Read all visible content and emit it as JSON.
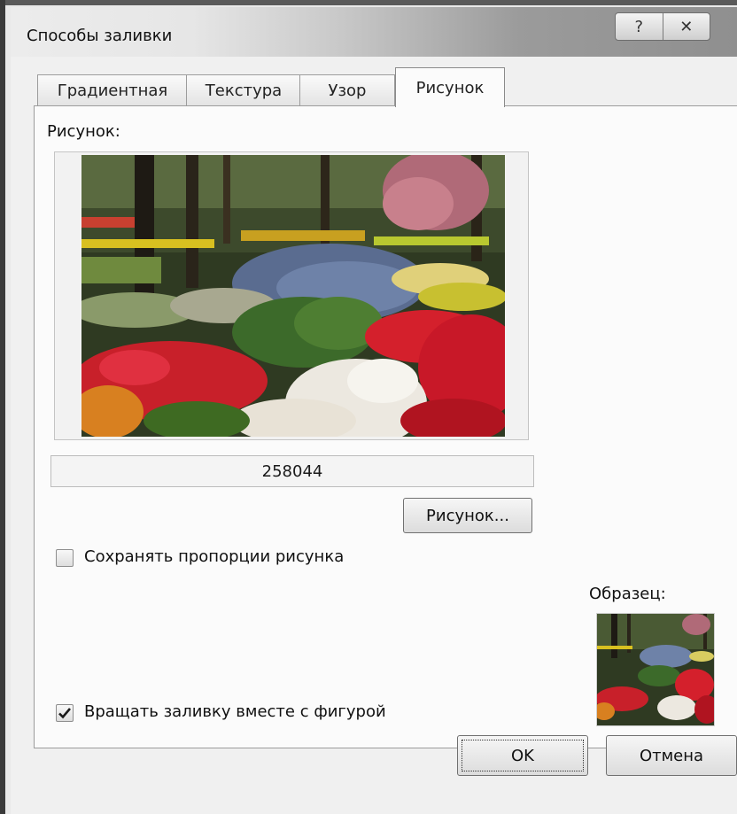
{
  "window": {
    "title": "Способы заливки",
    "help_glyph": "?",
    "close_glyph": "✕"
  },
  "tabs": [
    {
      "label": "Градиентная",
      "active": false
    },
    {
      "label": "Текстура",
      "active": false
    },
    {
      "label": "Узор",
      "active": false
    },
    {
      "label": "Рисунок",
      "active": true
    }
  ],
  "picture": {
    "section_label": "Рисунок:",
    "filename": "258044",
    "browse_button": "Рисунок..."
  },
  "options": {
    "keep_proportions": {
      "label": "Сохранять пропорции рисунка",
      "checked": false
    },
    "rotate_with_shape": {
      "label": "Вращать заливку вместе с фигурой",
      "checked": true
    }
  },
  "preview": {
    "label": "Образец:"
  },
  "footer": {
    "ok": "OK",
    "cancel": "Отмена"
  }
}
